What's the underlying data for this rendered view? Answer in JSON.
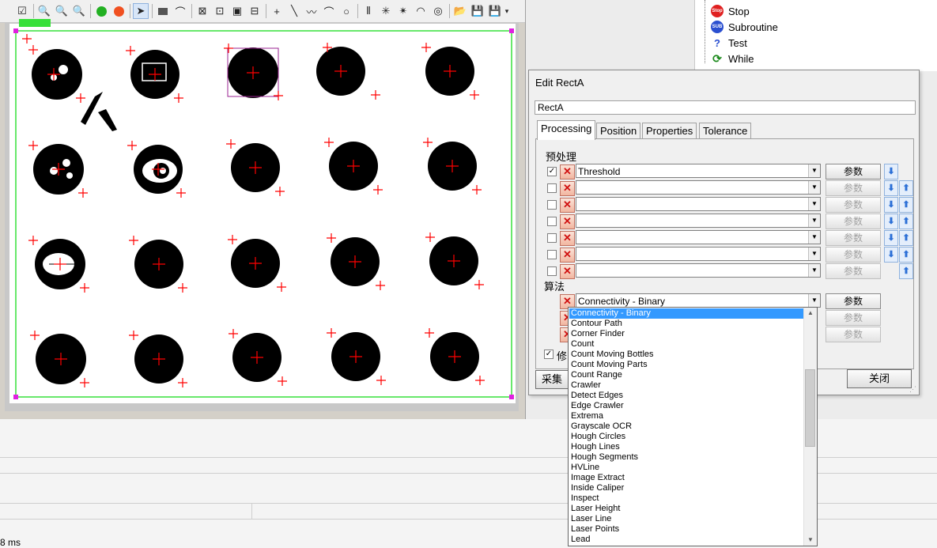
{
  "tree": {
    "items": [
      {
        "label": "Stop",
        "icon": "stop-icon",
        "color": "#e02020"
      },
      {
        "label": "Subroutine",
        "icon": "sub-icon",
        "color": "#2a4fd0"
      },
      {
        "label": "Test",
        "icon": "test-icon",
        "color": "#2a4fd0"
      },
      {
        "label": "While",
        "icon": "while-icon",
        "color": "#1c8a1c"
      }
    ],
    "sub_badge": "SUB",
    "stop_badge": "Stop",
    "test_badge": "?"
  },
  "dialog": {
    "title": "Edit RectA",
    "name_value": "RectA",
    "tabs": [
      "Processing",
      "Position",
      "Properties",
      "Tolerance"
    ],
    "active_tab": "Processing",
    "preprocess_label": "预处理",
    "algorithm_label": "算法",
    "param_label": "参数",
    "preprocess_rows": [
      {
        "checked": true,
        "value": "Threshold",
        "enabled": true
      },
      {
        "checked": false,
        "value": "",
        "enabled": false
      },
      {
        "checked": false,
        "value": "",
        "enabled": false
      },
      {
        "checked": false,
        "value": "",
        "enabled": false
      },
      {
        "checked": false,
        "value": "",
        "enabled": false
      },
      {
        "checked": false,
        "value": "",
        "enabled": false
      },
      {
        "checked": false,
        "value": "",
        "enabled": false
      }
    ],
    "algorithm_value": "Connectivity - Binary",
    "partial_check_label": "修",
    "capture_label": "采集",
    "close_label": "关闭"
  },
  "dropdown": {
    "items": [
      "Connectivity - Binary",
      "Contour Path",
      "Corner Finder",
      "Count",
      "Count Moving Bottles",
      "Count Moving Parts",
      "Count Range",
      "Crawler",
      "Detect Edges",
      "Edge Crawler",
      "Extrema",
      "Grayscale OCR",
      "Hough Circles",
      "Hough Lines",
      "Hough Segments",
      "HVLine",
      "Image Extract",
      "Inside Caliper",
      "Inspect",
      "Laser Height",
      "Laser Line",
      "Laser Points",
      "Lead"
    ],
    "selected": "Connectivity - Binary"
  },
  "status": {
    "time": "8 ms"
  },
  "colors": {
    "roi": "#37e03a",
    "accent": "#3399ff",
    "marker": "#ff0000"
  }
}
